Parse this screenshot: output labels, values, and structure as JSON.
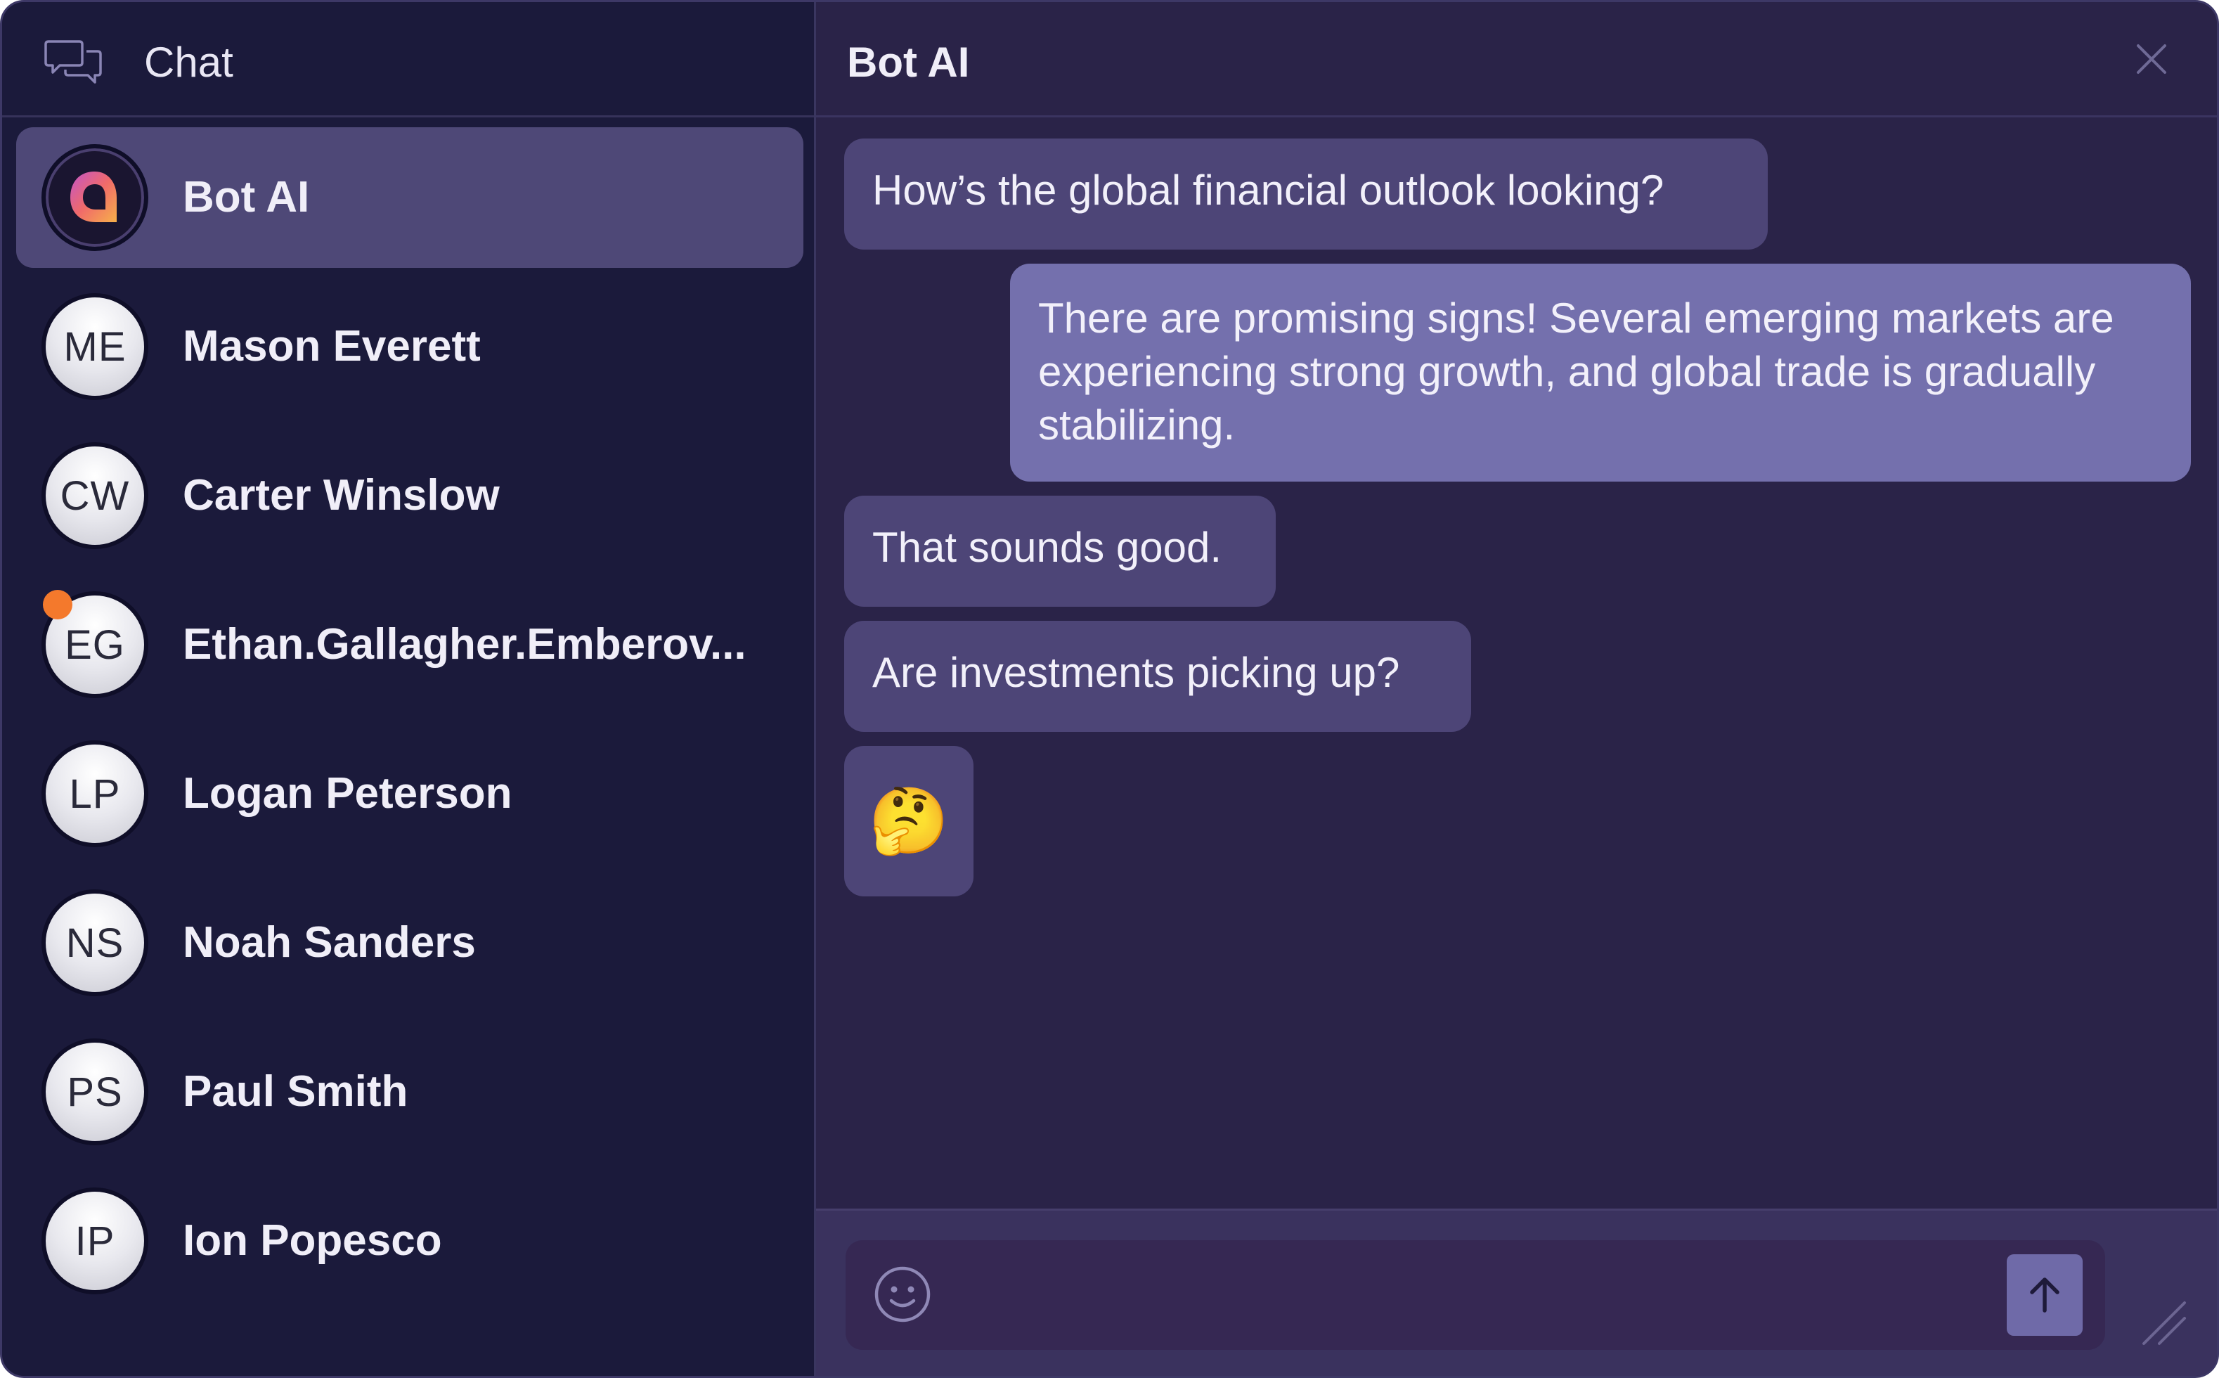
{
  "sidebar": {
    "title": "Chat",
    "contacts": [
      {
        "name": "Bot AI",
        "initials": "",
        "active": true,
        "unread": false,
        "avatar": "bot-logo"
      },
      {
        "name": "Mason Everett",
        "initials": "ME",
        "active": false,
        "unread": false
      },
      {
        "name": "Carter Winslow",
        "initials": "CW",
        "active": false,
        "unread": false
      },
      {
        "name": "Ethan.Gallagher.Emberov...",
        "initials": "EG",
        "active": false,
        "unread": true
      },
      {
        "name": "Logan Peterson",
        "initials": "LP",
        "active": false,
        "unread": false
      },
      {
        "name": "Noah Sanders",
        "initials": "NS",
        "active": false,
        "unread": false
      },
      {
        "name": "Paul Smith",
        "initials": "PS",
        "active": false,
        "unread": false
      },
      {
        "name": "Ion Popesco",
        "initials": "IP",
        "active": false,
        "unread": false
      }
    ]
  },
  "conversation": {
    "title": "Bot AI",
    "messages": [
      {
        "direction": "in",
        "text": "How’s the global financial outlook looking?"
      },
      {
        "direction": "out",
        "text": "There are promising signs! Several emerging markets are experiencing strong growth, and global trade is gradually stabilizing."
      },
      {
        "direction": "in",
        "text": "That sounds good."
      },
      {
        "direction": "in",
        "text": "Are investments picking up?"
      },
      {
        "direction": "in",
        "text": "🤔"
      }
    ]
  },
  "composer": {
    "value": "",
    "placeholder": ""
  },
  "icons": {
    "sidebar_header": "chat-bubbles-icon",
    "close": "close-icon",
    "emoji": "smiley-icon",
    "send": "arrow-up-icon",
    "resize": "resize-grip-icon"
  },
  "colors": {
    "sidebar_bg": "#1b1a3b",
    "main_bg": "#2a2348",
    "active_contact": "#4e4877",
    "bubble_in": "#4d4577",
    "bubble_out": "#7470ad",
    "unread_dot": "#f4792c",
    "send_button": "#6f6aa8"
  }
}
